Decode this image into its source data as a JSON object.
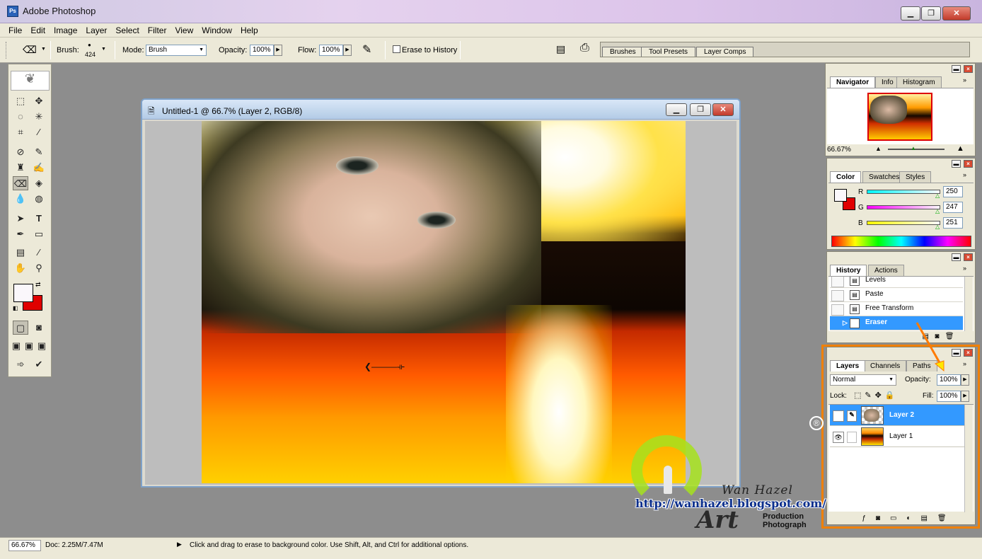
{
  "app": {
    "title": "Adobe Photoshop",
    "icon": "photoshop-icon"
  },
  "window_controls": {
    "minimize": "▁",
    "restore": "❐",
    "close": "✕"
  },
  "menu": [
    "File",
    "Edit",
    "Image",
    "Layer",
    "Select",
    "Filter",
    "View",
    "Window",
    "Help"
  ],
  "options": {
    "brush_label": "Brush:",
    "brush_size": "424",
    "mode_label": "Mode:",
    "mode_value": "Brush",
    "opacity_label": "Opacity:",
    "opacity_value": "100%",
    "flow_label": "Flow:",
    "flow_value": "100%",
    "erase_history_label": "Erase to History",
    "well_tabs": [
      "Brushes",
      "Tool Presets",
      "Layer Comps"
    ]
  },
  "document": {
    "title": "Untitled-1 @ 66.7% (Layer 2, RGB/8)"
  },
  "navigator": {
    "tabs": [
      "Navigator",
      "Info",
      "Histogram"
    ],
    "zoom": "66.67%"
  },
  "color_panel": {
    "tabs": [
      "Color",
      "Swatches",
      "Styles"
    ],
    "r_label": "R",
    "g_label": "G",
    "b_label": "B",
    "r": "250",
    "g": "247",
    "b": "251",
    "foreground": "#faf7fb",
    "background": "#e00000"
  },
  "history": {
    "tabs": [
      "History",
      "Actions"
    ],
    "items": [
      "Levels",
      "Paste",
      "Free Transform",
      "Eraser"
    ],
    "selected": "Eraser"
  },
  "layers": {
    "tabs": [
      "Layers",
      "Channels",
      "Paths"
    ],
    "blend_mode": "Normal",
    "opacity_label": "Opacity:",
    "opacity": "100%",
    "lock_label": "Lock:",
    "fill_label": "Fill:",
    "fill": "100%",
    "items": [
      "Layer 2",
      "Layer 1"
    ],
    "selected": "Layer 2"
  },
  "status": {
    "zoom": "66.67%",
    "doc": "Doc: 2.25M/7.47M",
    "hint": "Click and drag to erase to background color.  Use Shift, Alt, and Ctrl for additional options."
  },
  "watermark": {
    "registered": "®",
    "name": "Wan Hazel",
    "url": "http://wanhazel.blogspot.com/",
    "art": "Art",
    "production": "Production",
    "photograph": "Photograph"
  },
  "colors": {
    "accent": "#3399ff",
    "highlight_box": "#f08000",
    "menu_bg": "#ece9d8"
  }
}
